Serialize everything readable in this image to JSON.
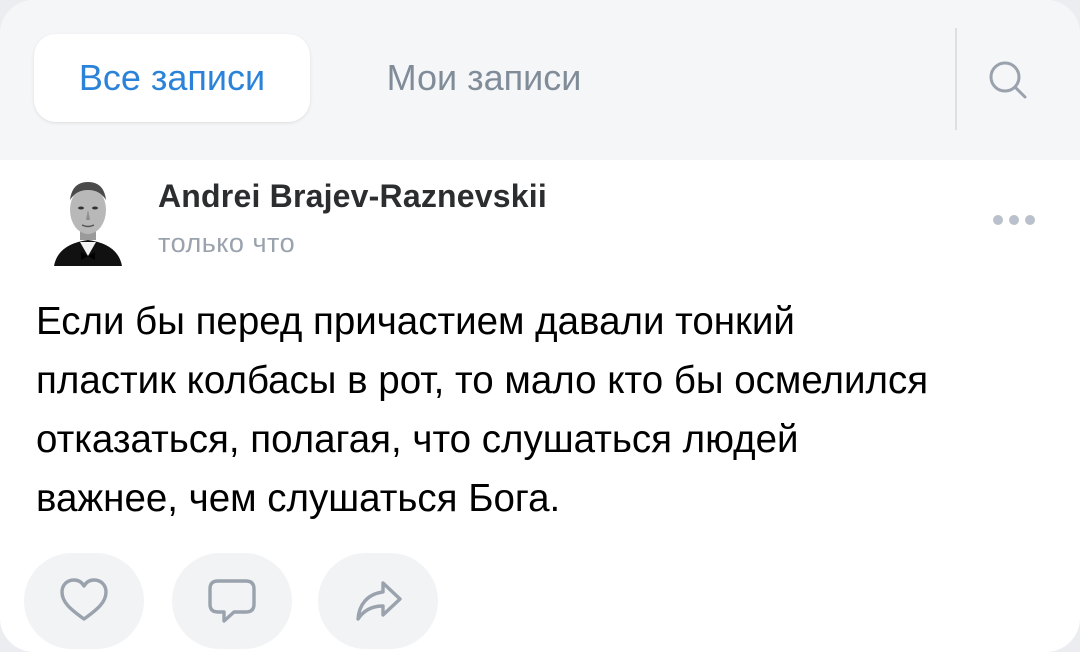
{
  "tabs": {
    "all_posts": "Все записи",
    "my_posts": "Мои записи"
  },
  "icons": {
    "search": "search-icon",
    "more": "more-horizontal-icon",
    "like": "heart-icon",
    "comment": "comment-icon",
    "share": "share-arrow-icon"
  },
  "post": {
    "author": "Andrei Brajev-Raznevskii",
    "time": "только что",
    "text_lines": [
      "Если бы перед причастием давали тонкий",
      "пластик колбасы в рот, то мало кто бы осмелился",
      "отказаться, полагая, что слушаться людей",
      "важнее, чем слушаться Бога."
    ]
  },
  "colors": {
    "accent": "#2b83d9",
    "secondary_text": "#818c99",
    "icon": "#99a2ad"
  }
}
